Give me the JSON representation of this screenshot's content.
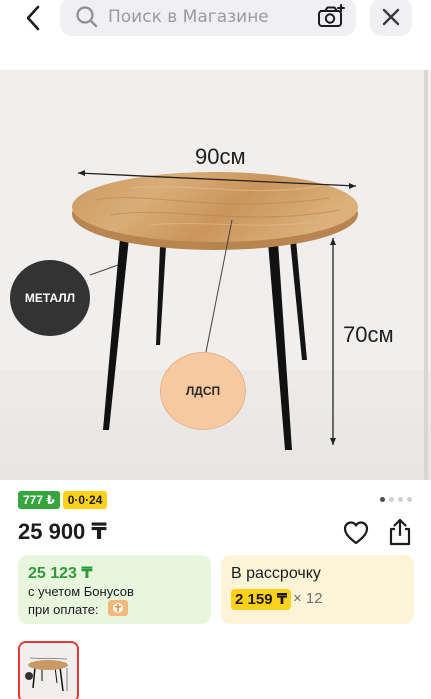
{
  "search": {
    "placeholder": "Поиск в Магазине"
  },
  "product_image": {
    "width_label": "90см",
    "height_label": "70см",
    "badge_metal": "МЕТАЛЛ",
    "badge_ldsp": "ЛДСП"
  },
  "rating": {
    "reviews_tag": "777 ₺",
    "installment_tag": "0·0·24"
  },
  "pagination": {
    "total": 4,
    "active": 1
  },
  "price": {
    "main": "25 900 ₸"
  },
  "bonus_card": {
    "amount": "25 123 ₸",
    "line1": "с учетом Бонусов",
    "line2": "при оплате:"
  },
  "installment_card": {
    "title": "В рассрочку",
    "amount": "2 159 ₸",
    "multiplier": "× 12"
  },
  "colors": {
    "accent_green": "#35a63e",
    "accent_yellow": "#ffd11a",
    "bonus_bg": "#e8f6de",
    "install_bg": "#fdf3d6",
    "thumb_border": "#e53935"
  },
  "icons": [
    "back-icon",
    "search-icon",
    "camera-icon",
    "close-icon",
    "heart-icon",
    "share-icon",
    "kaspi-icon"
  ]
}
